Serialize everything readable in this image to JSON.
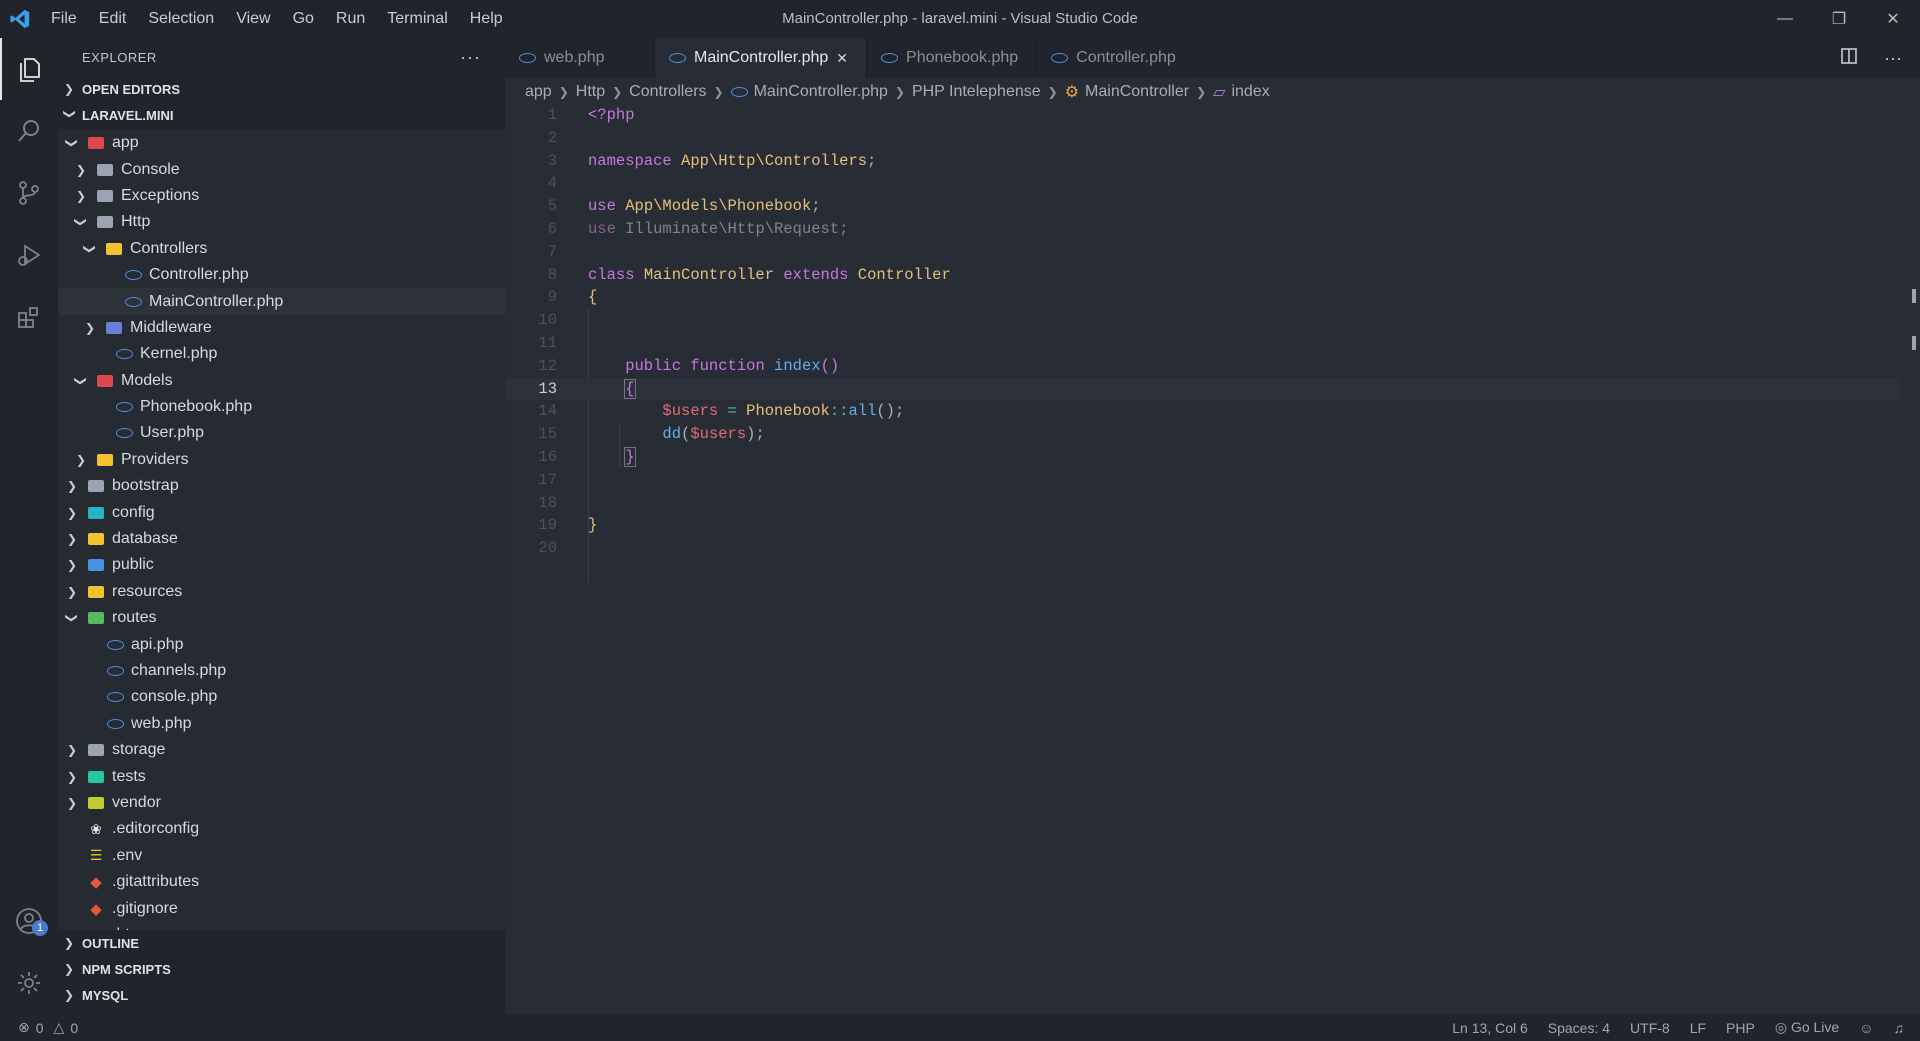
{
  "window": {
    "title": "MainController.php - laravel.mini - Visual Studio Code",
    "menu": [
      "File",
      "Edit",
      "Selection",
      "View",
      "Go",
      "Run",
      "Terminal",
      "Help"
    ]
  },
  "sidebar": {
    "header": "EXPLORER",
    "open_editors": "OPEN EDITORS",
    "project": "LARAVEL.MINI",
    "tree": [
      {
        "label": "app",
        "type": "folder",
        "depth": 1,
        "expanded": true,
        "color": "#e0474c"
      },
      {
        "label": "Console",
        "type": "folder",
        "depth": 2,
        "expanded": false,
        "color": "#9aa5b1"
      },
      {
        "label": "Exceptions",
        "type": "folder",
        "depth": 2,
        "expanded": false,
        "color": "#9aa5b1"
      },
      {
        "label": "Http",
        "type": "folder",
        "depth": 2,
        "expanded": true,
        "color": "#9aa5b1"
      },
      {
        "label": "Controllers",
        "type": "folder",
        "depth": 3,
        "expanded": true,
        "color": "#f1c232"
      },
      {
        "label": "Controller.php",
        "type": "php",
        "depth": 4
      },
      {
        "label": "MainController.php",
        "type": "php",
        "depth": 4,
        "selected": true
      },
      {
        "label": "Middleware",
        "type": "folder",
        "depth": 3,
        "expanded": false,
        "color": "#6c7fd8"
      },
      {
        "label": "Kernel.php",
        "type": "php",
        "depth": 3
      },
      {
        "label": "Models",
        "type": "folder",
        "depth": 2,
        "expanded": true,
        "color": "#e0474c"
      },
      {
        "label": "Phonebook.php",
        "type": "php",
        "depth": 3
      },
      {
        "label": "User.php",
        "type": "php",
        "depth": 3
      },
      {
        "label": "Providers",
        "type": "folder",
        "depth": 2,
        "expanded": false,
        "color": "#f1c232"
      },
      {
        "label": "bootstrap",
        "type": "folder",
        "depth": 1,
        "expanded": false,
        "color": "#9aa5b1"
      },
      {
        "label": "config",
        "type": "folder",
        "depth": 1,
        "expanded": false,
        "color": "#26b5c8"
      },
      {
        "label": "database",
        "type": "folder",
        "depth": 1,
        "expanded": false,
        "color": "#f1c232"
      },
      {
        "label": "public",
        "type": "folder",
        "depth": 1,
        "expanded": false,
        "color": "#4a90e2"
      },
      {
        "label": "resources",
        "type": "folder",
        "depth": 1,
        "expanded": false,
        "color": "#f1c232"
      },
      {
        "label": "routes",
        "type": "folder",
        "depth": 1,
        "expanded": true,
        "color": "#5cb85c"
      },
      {
        "label": "api.php",
        "type": "php",
        "depth": 2
      },
      {
        "label": "channels.php",
        "type": "php",
        "depth": 2
      },
      {
        "label": "console.php",
        "type": "php",
        "depth": 2
      },
      {
        "label": "web.php",
        "type": "php",
        "depth": 2
      },
      {
        "label": "storage",
        "type": "folder",
        "depth": 1,
        "expanded": false,
        "color": "#9aa5b1"
      },
      {
        "label": "tests",
        "type": "folder",
        "depth": 1,
        "expanded": false,
        "color": "#26c6a2"
      },
      {
        "label": "vendor",
        "type": "folder",
        "depth": 1,
        "expanded": false,
        "color": "#c0ca33"
      },
      {
        "label": ".editorconfig",
        "type": "editorconfig",
        "depth": 1
      },
      {
        "label": ".env",
        "type": "env",
        "depth": 1
      },
      {
        "label": ".gitattributes",
        "type": "git",
        "depth": 1
      },
      {
        "label": ".gitignore",
        "type": "git",
        "depth": 1
      },
      {
        "label": ".htaccess",
        "type": "htaccess",
        "depth": 1
      }
    ],
    "bottom_sections": [
      "OUTLINE",
      "NPM SCRIPTS",
      "MYSQL"
    ]
  },
  "tabs": [
    {
      "label": "web.php",
      "active": false
    },
    {
      "label": "MainController.php",
      "active": true
    },
    {
      "label": "Phonebook.php",
      "active": false
    },
    {
      "label": "Controller.php",
      "active": false
    }
  ],
  "breadcrumb": [
    "app",
    "Http",
    "Controllers",
    "MainController.php",
    "PHP Intelephense",
    "MainController",
    "index"
  ],
  "editor": {
    "current_line": 13,
    "lines": [
      {
        "n": "1",
        "tokens": [
          {
            "t": "<?php",
            "c": "kw"
          }
        ]
      },
      {
        "n": "2",
        "tokens": []
      },
      {
        "n": "3",
        "tokens": [
          {
            "t": "namespace ",
            "c": "kw"
          },
          {
            "t": "App\\Http\\Controllers",
            "c": "ns"
          },
          {
            "t": ";",
            "c": "pl"
          }
        ]
      },
      {
        "n": "4",
        "tokens": []
      },
      {
        "n": "5",
        "tokens": [
          {
            "t": "use ",
            "c": "kw"
          },
          {
            "t": "App\\Models\\Phonebook",
            "c": "ns"
          },
          {
            "t": ";",
            "c": "pl"
          }
        ]
      },
      {
        "n": "6",
        "tokens": [
          {
            "t": "use ",
            "c": "dimkw"
          },
          {
            "t": "Illuminate\\Http\\Request",
            "c": "dim"
          },
          {
            "t": ";",
            "c": "dim"
          }
        ]
      },
      {
        "n": "7",
        "tokens": []
      },
      {
        "n": "8",
        "tokens": [
          {
            "t": "class ",
            "c": "kw"
          },
          {
            "t": "MainController ",
            "c": "cls"
          },
          {
            "t": "extends ",
            "c": "kw"
          },
          {
            "t": "Controller",
            "c": "cls"
          }
        ]
      },
      {
        "n": "9",
        "tokens": [
          {
            "t": "{",
            "c": "brace"
          }
        ]
      },
      {
        "n": "10",
        "tokens": []
      },
      {
        "n": "11",
        "tokens": []
      },
      {
        "n": "12",
        "tokens": [
          {
            "t": "    public ",
            "c": "kw"
          },
          {
            "t": "function ",
            "c": "kw"
          },
          {
            "t": "index",
            "c": "fn"
          },
          {
            "t": "()",
            "c": "paren"
          }
        ]
      },
      {
        "n": "13",
        "tokens": [
          {
            "t": "    ",
            "c": "pl"
          },
          {
            "t": "{",
            "c": "paren bracebox"
          }
        ]
      },
      {
        "n": "14",
        "tokens": [
          {
            "t": "        ",
            "c": "pl"
          },
          {
            "t": "$users",
            "c": "var"
          },
          {
            "t": " = ",
            "c": "op"
          },
          {
            "t": "Phonebook",
            "c": "cls"
          },
          {
            "t": "::",
            "c": "op"
          },
          {
            "t": "all",
            "c": "fn"
          },
          {
            "t": "();",
            "c": "pl"
          }
        ]
      },
      {
        "n": "15",
        "tokens": [
          {
            "t": "        ",
            "c": "pl"
          },
          {
            "t": "dd",
            "c": "fn"
          },
          {
            "t": "(",
            "c": "pl"
          },
          {
            "t": "$users",
            "c": "var"
          },
          {
            "t": ");",
            "c": "pl"
          }
        ]
      },
      {
        "n": "16",
        "tokens": [
          {
            "t": "    ",
            "c": "pl"
          },
          {
            "t": "}",
            "c": "paren bracebox"
          }
        ]
      },
      {
        "n": "17",
        "tokens": []
      },
      {
        "n": "18",
        "tokens": []
      },
      {
        "n": "19",
        "tokens": [
          {
            "t": "}",
            "c": "brace"
          }
        ]
      },
      {
        "n": "20",
        "tokens": []
      }
    ]
  },
  "status": {
    "errors": "0",
    "warnings": "0",
    "position": "Ln 13, Col 6",
    "spaces": "Spaces: 4",
    "encoding": "UTF-8",
    "eol": "LF",
    "language": "PHP",
    "go_live": "Go Live"
  },
  "accounts_badge": "1"
}
